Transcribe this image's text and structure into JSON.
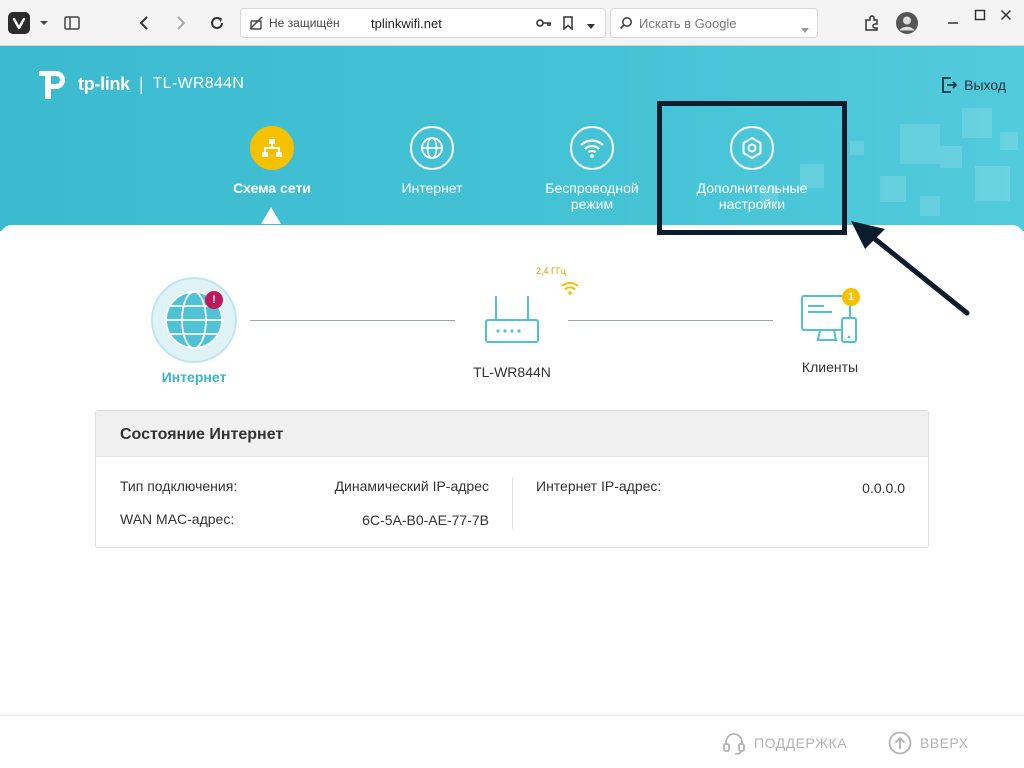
{
  "browser": {
    "security_label": "Не защищён",
    "url": "tplinkwifi.net",
    "search_placeholder": "Искать в Google"
  },
  "header": {
    "brand": "tp-link",
    "model": "TL-WR844N",
    "logout_label": "Выход"
  },
  "nav": {
    "items": [
      {
        "label": "Схема сети",
        "active": true
      },
      {
        "label": "Интернет",
        "active": false
      },
      {
        "label": "Беспроводной режим",
        "line1": "Беспроводной",
        "line2": "режим",
        "active": false
      },
      {
        "label": "Дополнительные настройки",
        "line1": "Дополнительные",
        "line2": "настройки",
        "active": false
      }
    ]
  },
  "topology": {
    "internet_label": "Интернет",
    "internet_badge": "!",
    "router_label": "TL-WR844N",
    "band_label": "2,4 ГГц",
    "clients_label": "Клиенты",
    "clients_count": "1"
  },
  "status_panel": {
    "title": "Состояние Интернет",
    "connection_type_label": "Тип подключения:",
    "connection_type_value": "Динамический IP-адрес",
    "wan_mac_label": "WAN MAC-адрес:",
    "wan_mac_value": "6C-5A-B0-AE-77-7B",
    "ip_label": "Интернет IP-адрес:",
    "ip_value": "0.0.0.0"
  },
  "footer": {
    "support_label": "ПОДДЕРЖКА",
    "top_label": "ВВЕРХ"
  },
  "colors": {
    "header_bg": "#42c0d4",
    "active_nav": "#f6c200",
    "alert_badge": "#c0185b",
    "client_badge": "#f6c200",
    "highlight_box": "#0e1d2e"
  }
}
